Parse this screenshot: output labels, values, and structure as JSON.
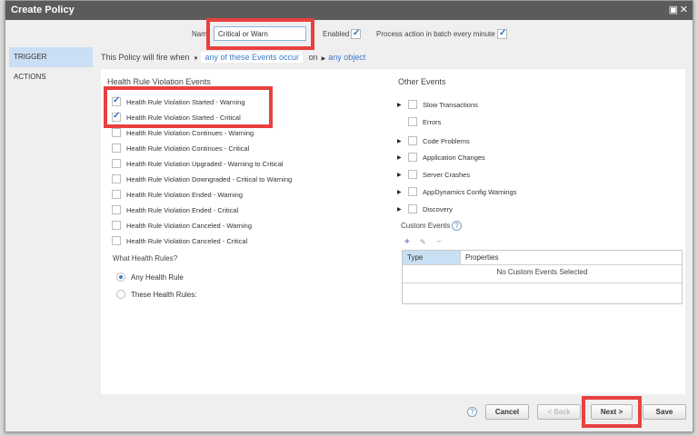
{
  "window": {
    "title": "Create Policy",
    "maximize_glyph": "▣",
    "close_glyph": "✕"
  },
  "header": {
    "name_label": "Nam",
    "name_value": "Critical or Warn",
    "enabled_label": "Enabled",
    "enabled": true,
    "batch_label": "Process action in batch every minute",
    "batch": true
  },
  "nav": {
    "items": [
      {
        "label": "TRIGGER",
        "active": true
      },
      {
        "label": "ACTIONS",
        "active": false
      }
    ]
  },
  "fire_line": {
    "prefix": "This Policy will fire when",
    "events_link": "any of these Events occur",
    "on": "on",
    "object_link": "any object"
  },
  "health_rule_events": {
    "title": "Health Rule Violation Events",
    "items": [
      {
        "label": "Health Rule Violation Started - Warning",
        "checked": true
      },
      {
        "label": "Health Rule Violation Started - Critical",
        "checked": true
      },
      {
        "label": "Health Rule Violation Continues - Warning",
        "checked": false
      },
      {
        "label": "Health Rule Violation Continues - Critical",
        "checked": false
      },
      {
        "label": "Health Rule Violation Upgraded - Warning to Critical",
        "checked": false
      },
      {
        "label": "Health Rule Violation Downgraded - Critical to Warning",
        "checked": false
      },
      {
        "label": "Health Rule Violation Ended - Warning",
        "checked": false
      },
      {
        "label": "Health Rule Violation Ended - Critical",
        "checked": false
      },
      {
        "label": "Health Rule Violation Canceled - Warning",
        "checked": false
      },
      {
        "label": "Health Rule Violation Canceled - Critical",
        "checked": false
      }
    ]
  },
  "health_rules": {
    "question": "What Health Rules?",
    "options": [
      {
        "label": "Any Health Rule",
        "selected": true
      },
      {
        "label": "These Health Rules:",
        "selected": false
      }
    ]
  },
  "other_events": {
    "title": "Other Events",
    "items": [
      {
        "label": "Slow Transactions",
        "expandable": true
      },
      {
        "label": "Errors",
        "expandable": false
      },
      {
        "label": "Code Problems",
        "expandable": true
      },
      {
        "label": "Application Changes",
        "expandable": true
      },
      {
        "label": "Server Crashes",
        "expandable": true
      },
      {
        "label": "AppDynamics Config Warnings",
        "expandable": true
      },
      {
        "label": "Discovery",
        "expandable": true
      }
    ]
  },
  "custom_events": {
    "label": "Custom Events",
    "help_glyph": "?",
    "add_glyph": "+",
    "edit_glyph": "✎",
    "remove_glyph": "−",
    "columns": [
      "Type",
      "Properties"
    ],
    "empty_text": "No Custom Events Selected"
  },
  "footer": {
    "help_glyph": "?",
    "cancel": "Cancel",
    "back": "< Back",
    "next": "Next >",
    "save": "Save"
  },
  "colors": {
    "highlight": "#e8403f",
    "accent": "#3b79c9",
    "selected_bg": "#c9dff3",
    "titlebar": "#5b5b5b"
  }
}
